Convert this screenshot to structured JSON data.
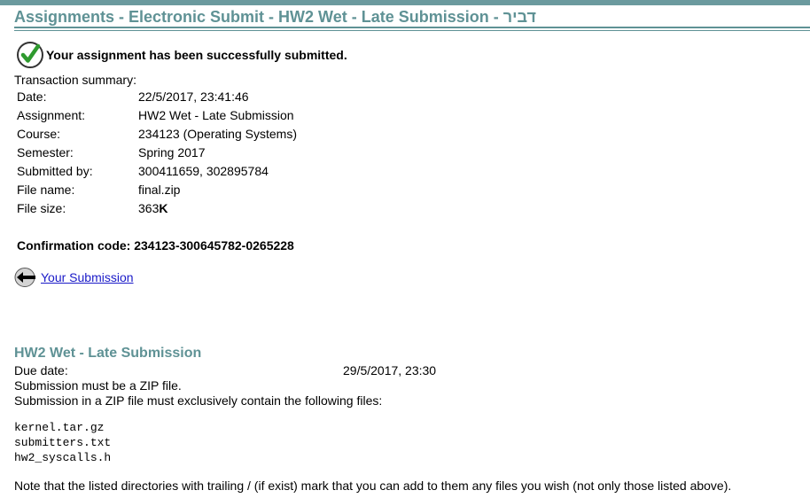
{
  "page": {
    "title": "Assignments - Electronic Submit - HW2 Wet - Late Submission - דביר"
  },
  "status": {
    "message": "Your assignment has been successfully submitted."
  },
  "summary": {
    "title": "Transaction summary:",
    "rows": [
      {
        "label": "Date:",
        "value": "22/5/2017, 23:41:46"
      },
      {
        "label": "Assignment:",
        "value": "HW2 Wet - Late Submission"
      },
      {
        "label": "Course:",
        "value": "234123 (Operating Systems)"
      },
      {
        "label": "Semester:",
        "value": "Spring 2017"
      },
      {
        "label": "Submitted by:",
        "value": "300411659, 302895784"
      },
      {
        "label": "File name:",
        "value": "final.zip"
      }
    ],
    "file_size_label": "File size:",
    "file_size_number": "363",
    "file_size_unit": "K"
  },
  "confirmation": {
    "text": "Confirmation code: 234123-300645782-0265228"
  },
  "nav": {
    "back_link": "Your Submission"
  },
  "assignment": {
    "title": "HW2 Wet - Late Submission",
    "due_label": "Due date:",
    "due_value": "29/5/2017, 23:30",
    "zip_note": "Submission must be a ZIP file.",
    "contain_note": "Submission in a ZIP file must exclusively contain the following files:",
    "files": [
      "kernel.tar.gz",
      "submitters.txt",
      "hw2_syscalls.h"
    ],
    "dir_note": "Note that the listed directories with trailing / (if exist) mark that you can add to them any files you wish (not only those listed above)."
  },
  "icons": {
    "success": "check-circle-icon",
    "back": "arrow-left-circle-icon"
  },
  "colors": {
    "heading": "#5f9295",
    "link": "#1a1ac8",
    "check": "#2e9a2e"
  }
}
